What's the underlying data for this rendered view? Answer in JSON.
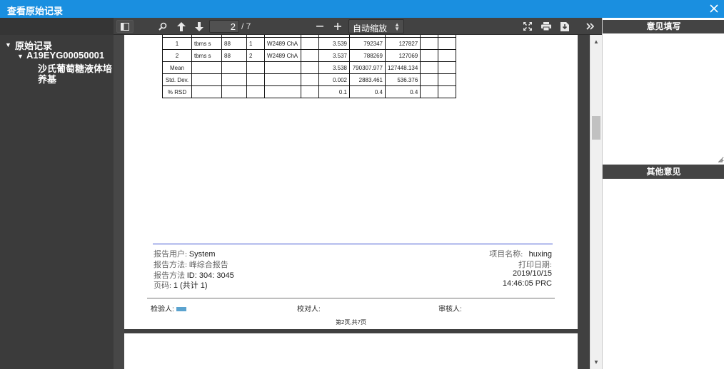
{
  "window": {
    "title": "查看原始记录"
  },
  "tree": {
    "root": "原始记录",
    "child": "A19EYG00050001",
    "leaf": "沙氏葡萄糖液体培养基"
  },
  "toolbar": {
    "page_value": "2",
    "page_count": "/ 7",
    "zoom": "自动缩放"
  },
  "report": {
    "rows": [
      {
        "id": "1",
        "name": "tbms s",
        "col3": "88",
        "col4": "1",
        "channel": "W2489 ChA",
        "time": "3.539",
        "area": "792347",
        "height": "127827"
      },
      {
        "id": "2",
        "name": "tbms s",
        "col3": "88",
        "col4": "2",
        "channel": "W2489 ChA",
        "time": "3.537",
        "area": "788269",
        "height": "127069"
      }
    ],
    "stats": [
      {
        "label": "Mean",
        "time": "3.538",
        "area": "790307.977",
        "height": "127448.134"
      },
      {
        "label": "Std. Dev.",
        "time": "0.002",
        "area": "2883.461",
        "height": "536.376"
      },
      {
        "label": "% RSD",
        "time": "0.1",
        "area": "0.4",
        "height": "0.4"
      }
    ],
    "footer": {
      "user_label": "报告用户:",
      "user_value": "System",
      "method_label": "报告方法:",
      "method_value": "峰综合报告",
      "method_id_label": "报告方法",
      "method_id_value": "ID: 304: 3045",
      "page_label": "页码:",
      "page_value": "1 (共计 1)",
      "project_label": "项目名称:",
      "project_value": "huxing",
      "print_date_label": "打印日期:",
      "print_date_value": "2019/10/15",
      "print_time_value": "14:46:05 PRC"
    },
    "signatures": {
      "tester": "检验人:",
      "checker": "校对人:",
      "reviewer": "审核人:"
    },
    "page_number": "第2页,共7页"
  },
  "right_panel": {
    "opinion_title": "意见填写",
    "other_title": "其他意见"
  },
  "colors": {
    "titlebar": "#1a8fe0",
    "footer_rule": "#3a4fd0"
  }
}
